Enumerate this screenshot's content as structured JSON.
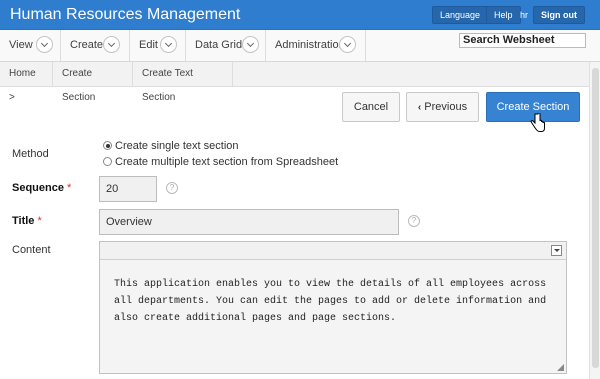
{
  "header": {
    "app_title": "Human Resources Management",
    "language_label": "Language",
    "help_label": "Help",
    "user": "hr",
    "signout_label": "Sign out",
    "color": "#2f7dce"
  },
  "menu": {
    "items": [
      {
        "label": "View"
      },
      {
        "label": "Create"
      },
      {
        "label": "Edit"
      },
      {
        "label": "Data Grid"
      },
      {
        "label": "Administration"
      }
    ],
    "search_placeholder": "Search Websheet"
  },
  "breadcrumb": {
    "items": [
      "Home",
      "Create Section",
      "Create Text Section"
    ],
    "separator": ">"
  },
  "actions": {
    "cancel_label": "Cancel",
    "previous_label": "Previous",
    "previous_icon": "chevron-left-icon",
    "create_label": "Create Section",
    "primary_color": "#3683d4"
  },
  "form": {
    "method_label": "Method",
    "method_options": [
      {
        "label": "Create single text section",
        "checked": true
      },
      {
        "label": "Create multiple text section from Spreadsheet",
        "checked": false
      }
    ],
    "sequence_label": "Sequence",
    "sequence_value": "20",
    "title_label": "Title",
    "title_value": "Overview",
    "required_marker": "*",
    "help_icon": "question-icon",
    "help_glyph": "?",
    "content_label": "Content",
    "content_text": "This application enables you to view the details of all employees across\nall departments. You can edit the pages to add or delete information and\nalso create additional pages and page sections."
  }
}
